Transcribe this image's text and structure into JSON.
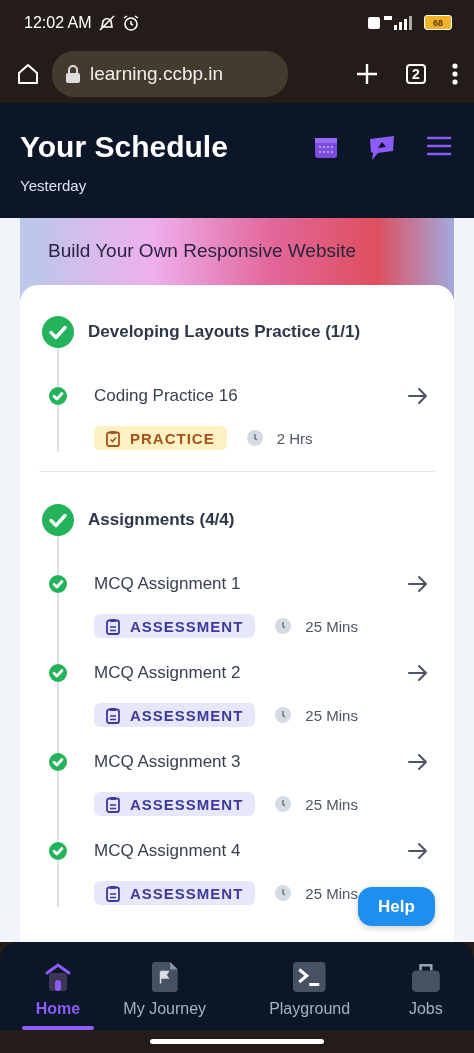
{
  "status_bar": {
    "time": "12:02 AM",
    "battery": "68"
  },
  "browser": {
    "url": "learning.ccbp.in",
    "tab_count": "2"
  },
  "header": {
    "title": "Your Schedule",
    "subtitle": "Yesterday"
  },
  "banner": {
    "title": "Build Your Own Responsive Website"
  },
  "groups": [
    {
      "title": "Developing Layouts Practice (1/1)",
      "completed": true,
      "items": [
        {
          "title": "Coding Practice 16",
          "completed": true,
          "tag": {
            "kind": "practice",
            "label": "PRACTICE"
          },
          "duration": "2 Hrs"
        }
      ]
    },
    {
      "title": "Assignments (4/4)",
      "completed": true,
      "items": [
        {
          "title": "MCQ Assignment 1",
          "completed": true,
          "tag": {
            "kind": "assessment",
            "label": "ASSESSMENT"
          },
          "duration": "25 Mins"
        },
        {
          "title": "MCQ Assignment 2",
          "completed": true,
          "tag": {
            "kind": "assessment",
            "label": "ASSESSMENT"
          },
          "duration": "25 Mins"
        },
        {
          "title": "MCQ Assignment 3",
          "completed": true,
          "tag": {
            "kind": "assessment",
            "label": "ASSESSMENT"
          },
          "duration": "25 Mins"
        },
        {
          "title": "MCQ Assignment 4",
          "completed": true,
          "tag": {
            "kind": "assessment",
            "label": "ASSESSMENT"
          },
          "duration": "25 Mins"
        }
      ]
    }
  ],
  "help_button": "Help",
  "nav": [
    {
      "label": "Home",
      "kind": "home",
      "selected": true
    },
    {
      "label": "My Journey",
      "kind": "journey",
      "selected": false
    },
    {
      "label": "Playground",
      "kind": "terminal",
      "selected": false
    },
    {
      "label": "Jobs",
      "kind": "jobs",
      "selected": false
    }
  ]
}
